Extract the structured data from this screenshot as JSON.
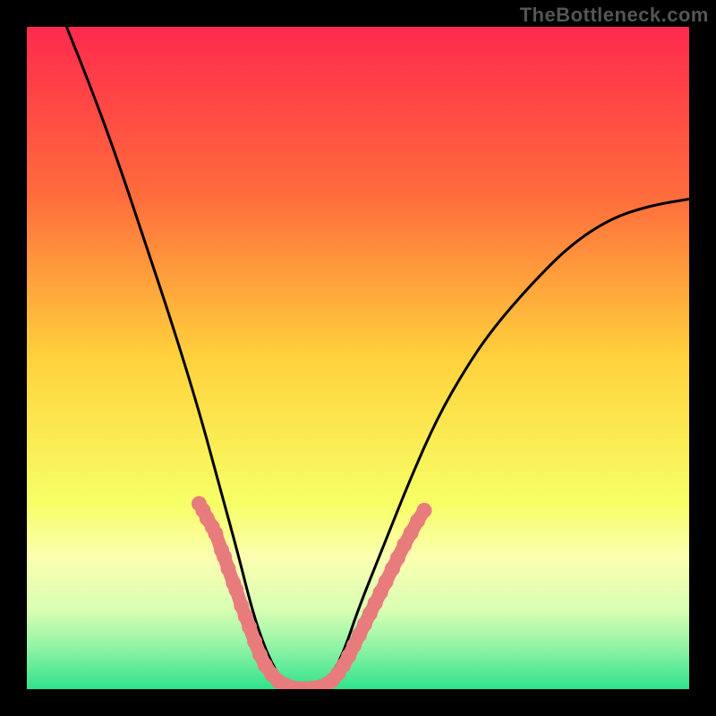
{
  "watermark": "TheBottleneck.com",
  "chart_data": {
    "type": "line",
    "title": "",
    "xlabel": "",
    "ylabel": "",
    "xlim": [
      0,
      100
    ],
    "ylim": [
      0,
      100
    ],
    "gradient_stops": [
      {
        "offset": 0,
        "color": "#ff2a4d"
      },
      {
        "offset": 0.25,
        "color": "#ff6a3c"
      },
      {
        "offset": 0.5,
        "color": "#ffd23c"
      },
      {
        "offset": 0.72,
        "color": "#f7ff66"
      },
      {
        "offset": 0.8,
        "color": "#fbffb0"
      },
      {
        "offset": 0.88,
        "color": "#d9ffb3"
      },
      {
        "offset": 0.94,
        "color": "#8cf2a4"
      },
      {
        "offset": 1.0,
        "color": "#2fe38c"
      }
    ],
    "series": [
      {
        "name": "curve",
        "x": [
          6,
          10,
          14,
          18,
          22,
          26,
          29,
          32,
          34,
          36,
          38,
          40,
          42,
          44,
          46,
          48,
          50,
          54,
          58,
          62,
          66,
          70,
          76,
          82,
          88,
          94,
          100
        ],
        "values": [
          100,
          90,
          79,
          67,
          55,
          42,
          31,
          20,
          12,
          6,
          2,
          0,
          0,
          0,
          2,
          6,
          12,
          22,
          32,
          41,
          48,
          54,
          61,
          67,
          71,
          73,
          74
        ]
      }
    ],
    "dot_segments": [
      {
        "name": "left-dots",
        "points": [
          {
            "x": 26.0,
            "y": 28.0
          },
          {
            "x": 26.6,
            "y": 27.0
          },
          {
            "x": 27.2,
            "y": 25.8
          },
          {
            "x": 28.0,
            "y": 24.5
          },
          {
            "x": 28.5,
            "y": 23.5
          },
          {
            "x": 29.4,
            "y": 21.0
          },
          {
            "x": 29.8,
            "y": 20.0
          },
          {
            "x": 30.4,
            "y": 18.2
          },
          {
            "x": 31.2,
            "y": 16.0
          },
          {
            "x": 31.6,
            "y": 15.0
          },
          {
            "x": 32.4,
            "y": 12.6
          },
          {
            "x": 33.0,
            "y": 11.0
          },
          {
            "x": 33.6,
            "y": 9.4
          },
          {
            "x": 34.4,
            "y": 7.2
          },
          {
            "x": 35.2,
            "y": 5.2
          },
          {
            "x": 36.0,
            "y": 3.6
          },
          {
            "x": 37.0,
            "y": 2.2
          },
          {
            "x": 38.0,
            "y": 1.2
          }
        ]
      },
      {
        "name": "bottom-dots",
        "points": [
          {
            "x": 39.0,
            "y": 0.6
          },
          {
            "x": 39.8,
            "y": 0.3
          },
          {
            "x": 40.6,
            "y": 0.1
          },
          {
            "x": 41.4,
            "y": 0.05
          },
          {
            "x": 42.2,
            "y": 0.05
          },
          {
            "x": 43.0,
            "y": 0.1
          },
          {
            "x": 43.8,
            "y": 0.2
          },
          {
            "x": 44.6,
            "y": 0.4
          },
          {
            "x": 45.4,
            "y": 0.8
          }
        ]
      },
      {
        "name": "right-dots",
        "points": [
          {
            "x": 46.2,
            "y": 1.4
          },
          {
            "x": 47.0,
            "y": 2.4
          },
          {
            "x": 47.8,
            "y": 3.6
          },
          {
            "x": 48.6,
            "y": 5.0
          },
          {
            "x": 49.4,
            "y": 6.6
          },
          {
            "x": 50.2,
            "y": 8.2
          },
          {
            "x": 51.0,
            "y": 9.8
          },
          {
            "x": 51.8,
            "y": 11.4
          },
          {
            "x": 52.6,
            "y": 13.0
          },
          {
            "x": 53.4,
            "y": 14.6
          },
          {
            "x": 54.2,
            "y": 16.2
          },
          {
            "x": 55.2,
            "y": 18.2
          },
          {
            "x": 56.0,
            "y": 19.8
          },
          {
            "x": 57.0,
            "y": 21.8
          },
          {
            "x": 58.0,
            "y": 23.6
          },
          {
            "x": 59.0,
            "y": 25.4
          },
          {
            "x": 60.0,
            "y": 27.0
          }
        ]
      }
    ],
    "colors": {
      "curve": "#000000",
      "dots": "#e87c7c"
    }
  }
}
